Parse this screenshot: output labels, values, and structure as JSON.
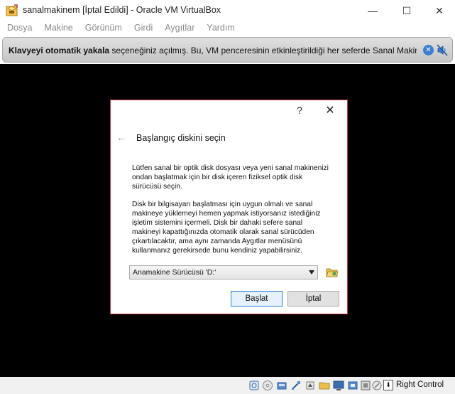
{
  "window": {
    "title": "sanalmakinem [İptal Edildi] - Oracle VM VirtualBox",
    "minimize_glyph": "—",
    "maximize_glyph": "☐",
    "close_glyph": "✕"
  },
  "menu": {
    "items": [
      "Dosya",
      "Makine",
      "Görünüm",
      "Girdi",
      "Aygıtlar",
      "Yardım"
    ]
  },
  "notification": {
    "bold_text": "Klavyeyi otomatik yakala",
    "text": " seçeneğiniz açılmış. Bu, VM penceresinin etkinleştirildiği her seferde Sanal Makinenin",
    "close_glyph": "✕"
  },
  "dialog": {
    "help_glyph": "?",
    "close_glyph": "✕",
    "back_glyph": "←",
    "title": "Başlangıç diskini seçin",
    "paragraph1_lines": [
      "Lütfen sanal bir optik disk dosyası veya yeni sanal makinenizi",
      "ondan başlatmak için bir disk içeren fiziksel optik disk",
      "sürücüsü seçin."
    ],
    "paragraph2_lines": [
      "Disk bir bilgisayarı başlatması için uygun olmalı ve sanal",
      "makineye yüklemeyi hemen yapmak istiyorsanız istediğiniz",
      "işletim sistemini içermeli. Disk bir dahaki sefere sanal",
      "makineyi kapattığınızda otomatik olarak sanal sürücüden",
      "çıkartılacaktır, ama aynı zamanda Aygıtlar menüsünü",
      "kullanmanız gerekirsede bunu kendiniz yapabilirsiniz."
    ],
    "drive_selected": "Anamakine Sürücüsü 'D:'",
    "start_label": "Başlat",
    "cancel_label": "İptal"
  },
  "statusbar": {
    "host_key_label": "Right Control",
    "host_key_arrow": "⬇"
  },
  "colors": {
    "dialog_border": "#c43a3a",
    "vm_background": "#000000",
    "primary_button_border": "#2f7ed7",
    "notice_close": "#3a7fd0"
  }
}
